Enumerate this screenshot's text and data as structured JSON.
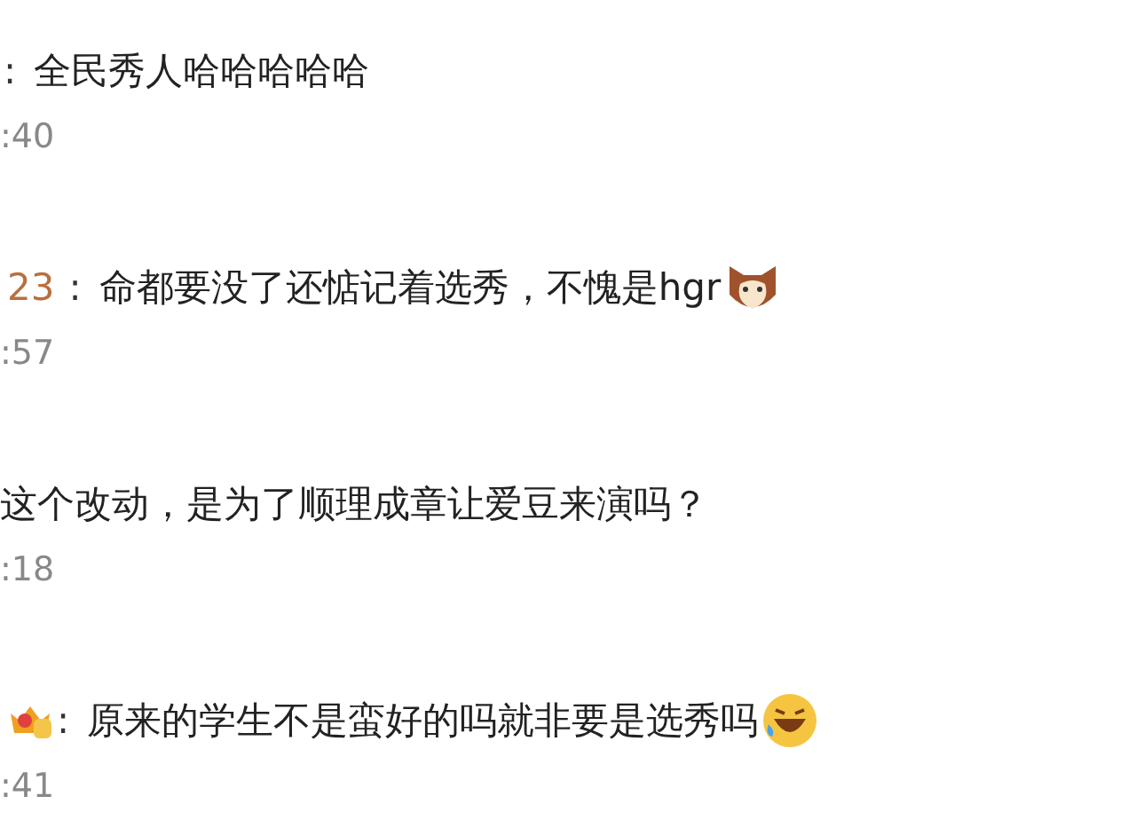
{
  "comments": [
    {
      "separator": ":",
      "text": "全民秀人哈哈哈哈哈",
      "time": ":40"
    },
    {
      "username": "23",
      "separator": ":",
      "text": "命都要没了还惦记着选秀，不愧是hgr",
      "emoji": {
        "kind": "cat"
      },
      "time": ":57"
    },
    {
      "text": "这个改动，是为了顺理成章让爱豆来演吗？",
      "time": ":18"
    },
    {
      "badge": {
        "kind": "crown"
      },
      "separator": ":",
      "text": "原来的学生不是蛮好的吗就非要是选秀吗",
      "emoji": {
        "kind": "laugh"
      },
      "time": ":41"
    }
  ]
}
